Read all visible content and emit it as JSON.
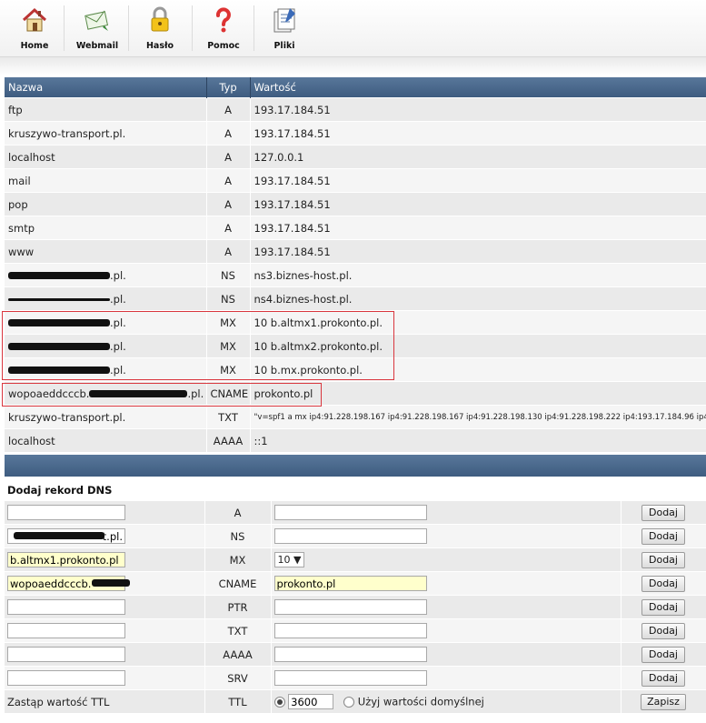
{
  "toolbar": {
    "items": [
      {
        "label": "Home",
        "icon": "home-icon"
      },
      {
        "label": "Webmail",
        "icon": "webmail-icon"
      },
      {
        "label": "Hasło",
        "icon": "padlock-icon"
      },
      {
        "label": "Pomoc",
        "icon": "question-mark-icon"
      },
      {
        "label": "Pliki",
        "icon": "files-icon"
      }
    ]
  },
  "table": {
    "headers": {
      "name": "Nazwa",
      "type": "Typ",
      "value": "Wartość"
    },
    "rows": [
      {
        "name": "ftp",
        "type": "A",
        "value": "193.17.184.51"
      },
      {
        "name": "kruszywo-transport.pl.",
        "type": "A",
        "value": "193.17.184.51"
      },
      {
        "name": "localhost",
        "type": "A",
        "value": "127.0.0.1"
      },
      {
        "name": "mail",
        "type": "A",
        "value": "193.17.184.51"
      },
      {
        "name": "pop",
        "type": "A",
        "value": "193.17.184.51"
      },
      {
        "name": "smtp",
        "type": "A",
        "value": "193.17.184.51"
      },
      {
        "name": "www",
        "type": "A",
        "value": "193.17.184.51"
      },
      {
        "name": ".pl.",
        "type": "NS",
        "value": "ns3.biznes-host.pl."
      },
      {
        "name": ".pl.",
        "type": "NS",
        "value": "ns4.biznes-host.pl."
      },
      {
        "name": ".pl.",
        "type": "MX",
        "value": "10 b.altmx1.prokonto.pl."
      },
      {
        "name": ".pl.",
        "type": "MX",
        "value": "10 b.altmx2.prokonto.pl."
      },
      {
        "name": ".pl.",
        "type": "MX",
        "value": "10 b.mx.prokonto.pl."
      },
      {
        "name_prefix": "wopoaeddcccb.",
        "name": ".pl.",
        "type": "CNAME",
        "value": "prokonto.pl"
      },
      {
        "name": "kruszywo-transport.pl.",
        "type": "TXT",
        "value": "\"v=spf1 a mx ip4:91.228.198.167 ip4:91.228.198.167 ip4:91.228.198.130 ip4:91.228.198.222 ip4:193.17.184.96 ip4:193"
      },
      {
        "name": "localhost",
        "type": "AAAA",
        "value": "::1"
      }
    ]
  },
  "add_form": {
    "title": "Dodaj rekord DNS",
    "button_label": "Dodaj",
    "rows": [
      {
        "type": "A",
        "name_value": "",
        "value": ""
      },
      {
        "type": "NS",
        "name_value": "t.pl.",
        "value": ""
      },
      {
        "type": "MX",
        "name_value": "b.altmx1.prokonto.pl",
        "priority": "10"
      },
      {
        "type": "CNAME",
        "name_value": "wopoaeddcccb.",
        "value": "prokonto.pl"
      },
      {
        "type": "PTR",
        "name_value": "",
        "value": ""
      },
      {
        "type": "TXT",
        "name_value": "",
        "value": ""
      },
      {
        "type": "AAAA",
        "name_value": "",
        "value": ""
      },
      {
        "type": "SRV",
        "name_value": "",
        "value": ""
      }
    ],
    "ttl": {
      "label": "Zastąp wartość TTL",
      "type": "TTL",
      "value": "3600",
      "default_label": "Użyj wartości domyślnej",
      "button_label": "Zapisz"
    }
  }
}
